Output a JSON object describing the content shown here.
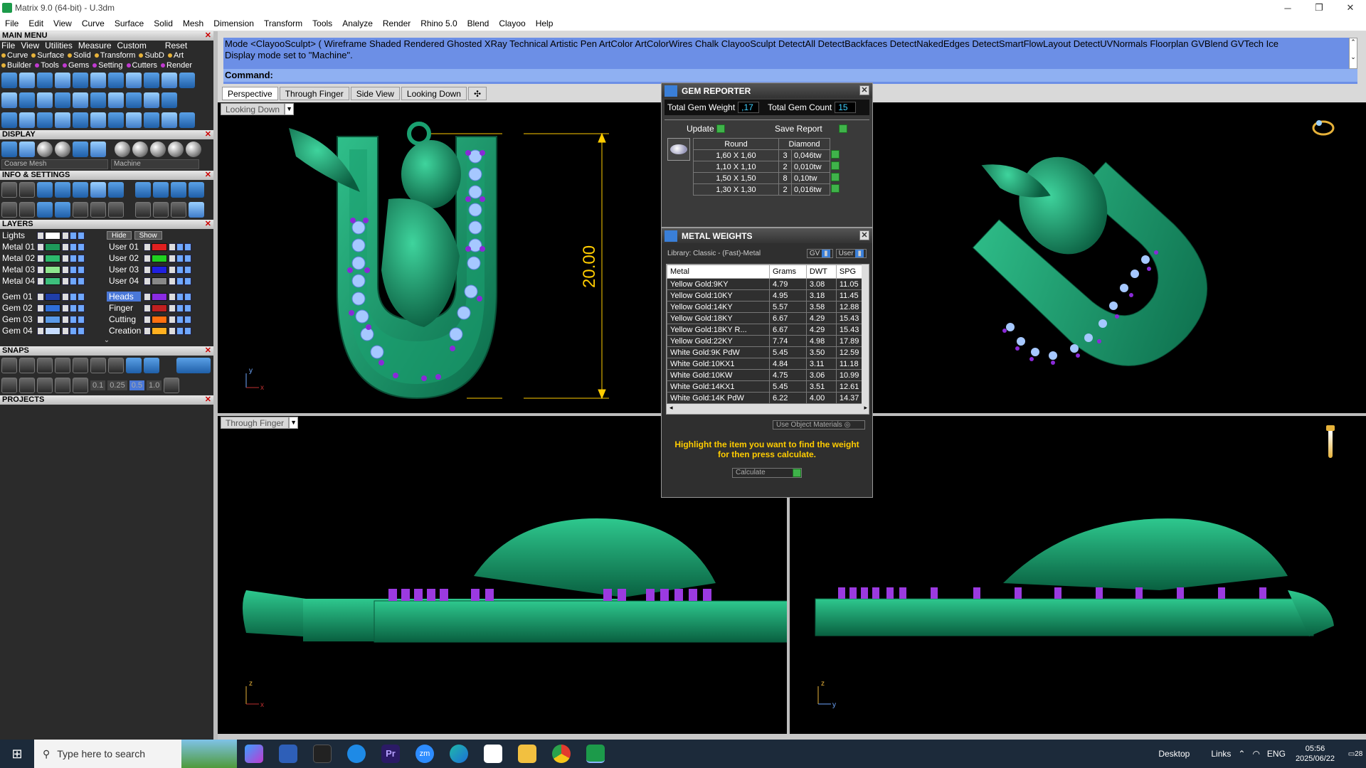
{
  "window": {
    "title": "Matrix 9.0 (64-bit) - U.3dm",
    "min": "─",
    "restore": "❐",
    "close": "✕"
  },
  "menubar": [
    "File",
    "Edit",
    "View",
    "Curve",
    "Surface",
    "Solid",
    "Mesh",
    "Dimension",
    "Transform",
    "Tools",
    "Analyze",
    "Render",
    "Rhino 5.0",
    "Blend",
    "Clayoo",
    "Help"
  ],
  "left": {
    "main_menu": "MAIN MENU",
    "main_row": [
      "File",
      "View",
      "Utilities",
      "Measure",
      "Custom",
      "Reset"
    ],
    "sub_row1": [
      {
        "label": "Curve",
        "color": "#e6b23a"
      },
      {
        "label": "Surface",
        "color": "#e6b23a"
      },
      {
        "label": "Solid",
        "color": "#e6b23a"
      },
      {
        "label": "Transform",
        "color": "#e6b23a"
      },
      {
        "label": "SubD",
        "color": "#e6b23a"
      },
      {
        "label": "Art",
        "color": "#e6b23a"
      }
    ],
    "sub_row2": [
      {
        "label": "Builder",
        "color": "#e6b23a"
      },
      {
        "label": "Tools",
        "color": "#c03ad0"
      },
      {
        "label": "Gems",
        "color": "#c03ad0"
      },
      {
        "label": "Setting",
        "color": "#c03ad0"
      },
      {
        "label": "Cutters",
        "color": "#c03ad0"
      },
      {
        "label": "Render",
        "color": "#c03ad0"
      }
    ],
    "display": "DISPLAY",
    "display_dd1": "Coarse Mesh",
    "display_dd2": "Machine",
    "info": "INFO & SETTINGS",
    "layers": "LAYERS",
    "lights": "Lights",
    "hide": "Hide",
    "show": "Show",
    "layers_left": [
      {
        "name": "Metal 01",
        "color": "#1e9a5a"
      },
      {
        "name": "Metal 02",
        "color": "#2dbb6d"
      },
      {
        "name": "Metal 03",
        "color": "#8ee68e"
      },
      {
        "name": "Metal 04",
        "color": "#3dbf7c"
      },
      {
        "name": "Gem 01",
        "color": "#1f3ea8"
      },
      {
        "name": "Gem 02",
        "color": "#2f6fd8"
      },
      {
        "name": "Gem 03",
        "color": "#5a9ae8"
      },
      {
        "name": "Gem 04",
        "color": "#c6dcff"
      }
    ],
    "layers_right": [
      {
        "name": "User 01",
        "color": "#e02020"
      },
      {
        "name": "User 02",
        "color": "#20d020"
      },
      {
        "name": "User 03",
        "color": "#2020e0"
      },
      {
        "name": "User 04",
        "color": "#888888"
      },
      {
        "name": "Heads",
        "color": "#8a2be2"
      },
      {
        "name": "Finger",
        "color": "#c02020"
      },
      {
        "name": "Cutting",
        "color": "#ff7010"
      },
      {
        "name": "Creation",
        "color": "#ffb020"
      }
    ],
    "snaps": "SNAPS",
    "snap_values": [
      "0.1",
      "0.25",
      "0.5",
      "1.0"
    ],
    "projects": "PROJECTS"
  },
  "command": {
    "line1": "Mode <ClayooSculpt> ( Wireframe  Shaded  Rendered  Ghosted  XRay  Technical  Artistic  Pen  ArtColor  ArtColorWires  Chalk  ClayooSculpt  DetectAll  DetectBackfaces  DetectNakedEdges  DetectSmartFlowLayout  DetectUVNormals  Floorplan  GVBlend  GVTech  Ice",
    "line2": "Display mode set to \"Machine\".",
    "prompt": "Command:"
  },
  "tabs": [
    "Perspective",
    "Through Finger",
    "Side View",
    "Looking Down"
  ],
  "tab_add": "✣",
  "viewports": {
    "top_left": "Looking Down",
    "bottom_left": "Through Finger"
  },
  "dimension": "20.00",
  "axes": {
    "tl": "y",
    "tl_x": "x",
    "bl": "z",
    "bl_x": "x",
    "br": "z",
    "br_y": "y"
  },
  "gem_reporter": {
    "title": "GEM REPORTER",
    "total_weight_label": "Total Gem Weight",
    "total_weight": ",17",
    "total_count_label": "Total Gem Count",
    "total_count": "15",
    "update": "Update",
    "save_report": "Save Report",
    "col1": "Round",
    "col2": "Diamond",
    "rows": [
      {
        "size": "1,60 X 1,60",
        "qty": "3",
        "wt": "0,046tw"
      },
      {
        "size": "1,10 X 1,10",
        "qty": "2",
        "wt": "0,010tw"
      },
      {
        "size": "1,50 X 1,50",
        "qty": "8",
        "wt": "0,10tw"
      },
      {
        "size": "1,30 X 1,30",
        "qty": "2",
        "wt": "0,016tw"
      }
    ]
  },
  "metal_weights": {
    "title": "METAL WEIGHTS",
    "library": "Library: Classic - (Fast)-Metal",
    "gv": "GV",
    "user": "User",
    "headers": [
      "Metal",
      "Grams",
      "DWT",
      "SPG"
    ],
    "rows": [
      [
        "Yellow Gold:9KY",
        "4.79",
        "3.08",
        "11.05"
      ],
      [
        "Yellow Gold:10KY",
        "4.95",
        "3.18",
        "11.45"
      ],
      [
        "Yellow Gold:14KY",
        "5.57",
        "3.58",
        "12.88"
      ],
      [
        "Yellow Gold:18KY",
        "6.67",
        "4.29",
        "15.43"
      ],
      [
        "Yellow Gold:18KY R...",
        "6.67",
        "4.29",
        "15.43"
      ],
      [
        "Yellow Gold:22KY",
        "7.74",
        "4.98",
        "17.89"
      ],
      [
        "White Gold:9K PdW",
        "5.45",
        "3.50",
        "12.59"
      ],
      [
        "White Gold:10KX1",
        "4.84",
        "3.11",
        "11.18"
      ],
      [
        "White Gold:10KW",
        "4.75",
        "3.06",
        "10.99"
      ],
      [
        "White Gold:14KX1",
        "5.45",
        "3.51",
        "12.61"
      ],
      [
        "White Gold:14K PdW",
        "6.22",
        "4.00",
        "14.37"
      ]
    ],
    "use_object_materials": "Use Object Materials",
    "hint": "Highlight the item you want to find the weight for then press calculate.",
    "calculate": "Calculate"
  },
  "taskbar": {
    "search_placeholder": "Type here to search",
    "desktop": "Desktop",
    "links": "Links",
    "lang": "ENG",
    "time": "05:56",
    "date": "2025/06/22",
    "notif": "28"
  }
}
